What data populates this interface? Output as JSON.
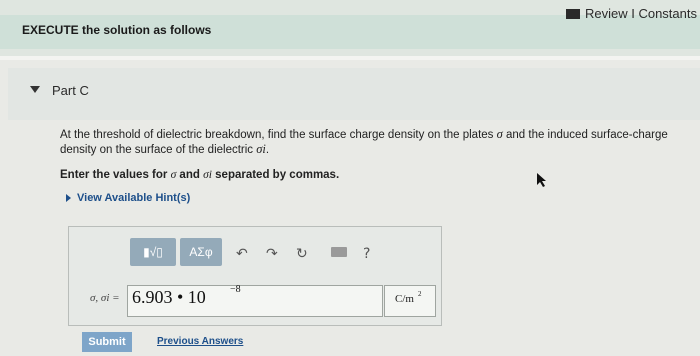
{
  "header": {
    "review_label": "Review I Constants",
    "execute_label": "EXECUTE the solution as follows"
  },
  "part": {
    "title": "Part C"
  },
  "question": {
    "text_before_sigma": "At the threshold of dielectric breakdown, find the surface charge density on the plates ",
    "sigma": "σ",
    "text_middle": " and the induced surface-charge density on the surface of the dielectric ",
    "sigma_i": "σi",
    "text_end": "."
  },
  "instruction": {
    "text_before": "Enter the values for ",
    "sigma": "σ",
    "and_text": " and ",
    "sigma_i": "σi",
    "text_after": " separated by commas."
  },
  "hints": {
    "label": "View Available Hint(s)"
  },
  "toolbar": {
    "templates_label": "▮√▯",
    "greek_label": "ΑΣφ",
    "undo_icon": "undo-icon",
    "redo_icon": "redo-icon",
    "reset_icon": "reset-icon",
    "keyboard_icon": "keyboard-icon",
    "help_label": "?"
  },
  "answer": {
    "variable_label": "σ, σi =",
    "value": "6.903 • 10",
    "exponent": "−8",
    "unit": "C/m",
    "unit_exponent": "2"
  },
  "actions": {
    "submit_label": "Submit",
    "previous_answers_label": "Previous Answers"
  },
  "colors": {
    "toolbar_button": "#94aab9",
    "submit_button": "#7ea5c9",
    "link": "#1d4f8a"
  }
}
